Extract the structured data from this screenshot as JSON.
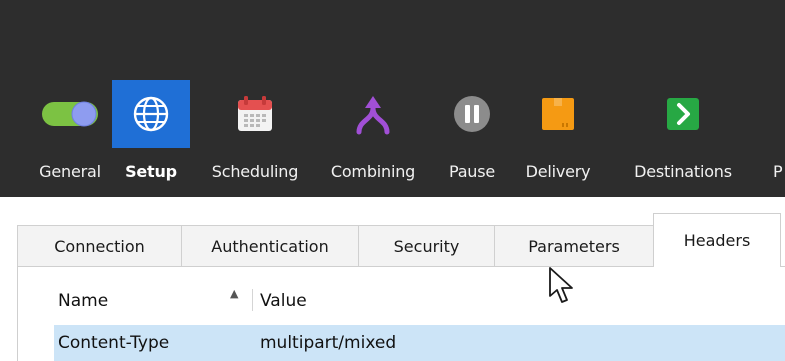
{
  "nav": {
    "items": [
      {
        "id": "general",
        "label": "General"
      },
      {
        "id": "setup",
        "label": "Setup"
      },
      {
        "id": "scheduling",
        "label": "Scheduling"
      },
      {
        "id": "combining",
        "label": "Combining"
      },
      {
        "id": "pause",
        "label": "Pause"
      },
      {
        "id": "delivery",
        "label": "Delivery"
      },
      {
        "id": "destinations",
        "label": "Destinations"
      },
      {
        "id": "more",
        "label": "P"
      }
    ],
    "active": "setup",
    "icons": [
      "toggle-switch-icon",
      "globe-icon",
      "calendar-icon",
      "merge-arrow-icon",
      "pause-icon",
      "package-icon",
      "chevron-right-icon"
    ]
  },
  "tabs": {
    "items": [
      "Connection",
      "Authentication",
      "Security",
      "Parameters",
      "Headers"
    ],
    "active": "Headers"
  },
  "table": {
    "columns": [
      "Name",
      "Value"
    ],
    "sorted_by": "Name",
    "sort_direction": "ascending",
    "rows": [
      {
        "name": "Content-Type",
        "value": "multipart/mixed",
        "selected": true
      }
    ]
  },
  "colors": {
    "top_bar": "#2d2d2d",
    "active_nav": "#1f6fd6",
    "selected_row": "#cce4f7"
  }
}
